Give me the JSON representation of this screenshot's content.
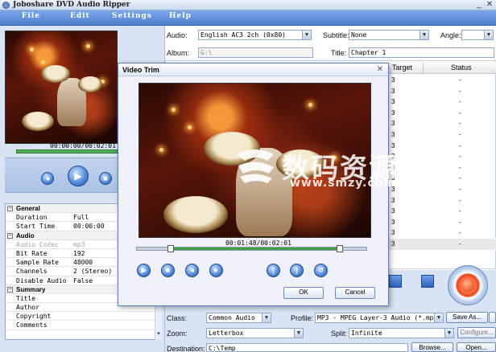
{
  "window": {
    "title": "Joboshare DVD Audio Ripper"
  },
  "menu": [
    "File",
    "Edit",
    "Settings",
    "Help"
  ],
  "preview": {
    "time": "00:00:00/00:02:01",
    "progress_fraction": 1.0
  },
  "properties": [
    {
      "type": "section",
      "label": "General"
    },
    {
      "key": "Duration",
      "value": "Full"
    },
    {
      "key": "Start Time",
      "value": "00:00:00"
    },
    {
      "type": "section",
      "label": "Audio"
    },
    {
      "key": "Audio Codec",
      "value": "mp3",
      "dim": true
    },
    {
      "key": "Bit Rate",
      "value": "192"
    },
    {
      "key": "Sample Rate",
      "value": "48000"
    },
    {
      "key": "Channels",
      "value": "2 (Stereo)"
    },
    {
      "key": "Disable Audio",
      "value": "False"
    },
    {
      "type": "section",
      "label": "Summary"
    },
    {
      "key": "Title",
      "value": ""
    },
    {
      "key": "Author",
      "value": ""
    },
    {
      "key": "Copyright",
      "value": ""
    },
    {
      "key": "Comments",
      "value": ""
    }
  ],
  "top": {
    "audio_label": "Audio:",
    "audio_value": "English AC3 2ch (0x80)",
    "subtitle_label": "Subtitle:",
    "subtitle_value": "None",
    "angle_label": "Angle:",
    "angle_value": "",
    "album_label": "Album:",
    "album_value": "G:\\",
    "title_label": "Title:",
    "title_value": "Chapter 1"
  },
  "list": {
    "columns": [
      "Target",
      "Status"
    ],
    "rows": [
      "3",
      "3",
      "3",
      "3",
      "3",
      "3",
      "3",
      "3",
      "3",
      "3",
      "3",
      "3",
      "3",
      "3",
      "3",
      "3"
    ],
    "status_value": "-"
  },
  "bottom": {
    "class_label": "Class:",
    "class_value": "Common Audio",
    "profile_label": "Profile:",
    "profile_value": "MP3 - MPEG Layer-3 Audio  (*.mp3)",
    "save_as": "Save As...",
    "zoom_label": "Zoom:",
    "zoom_value": "Letterbox",
    "split_label": "Split:",
    "split_value": "Infinite",
    "configure": "Configure...",
    "destination_label": "Destination:",
    "destination_value": "C:\\Temp",
    "browse": "Browse...",
    "open": "Open..."
  },
  "dialog": {
    "title": "Video Trim",
    "time": "00:01:48/00:02:01",
    "trim_start_fraction": 0.15,
    "trim_end_fraction": 0.88,
    "ok": "OK",
    "cancel": "Cancel"
  },
  "watermark": {
    "main": "数码资源网",
    "sub": "www.smzy.com"
  },
  "colors": {
    "menubar": "#4d7fd2",
    "progress": "#43a047",
    "panel": "#d8e4f4"
  }
}
